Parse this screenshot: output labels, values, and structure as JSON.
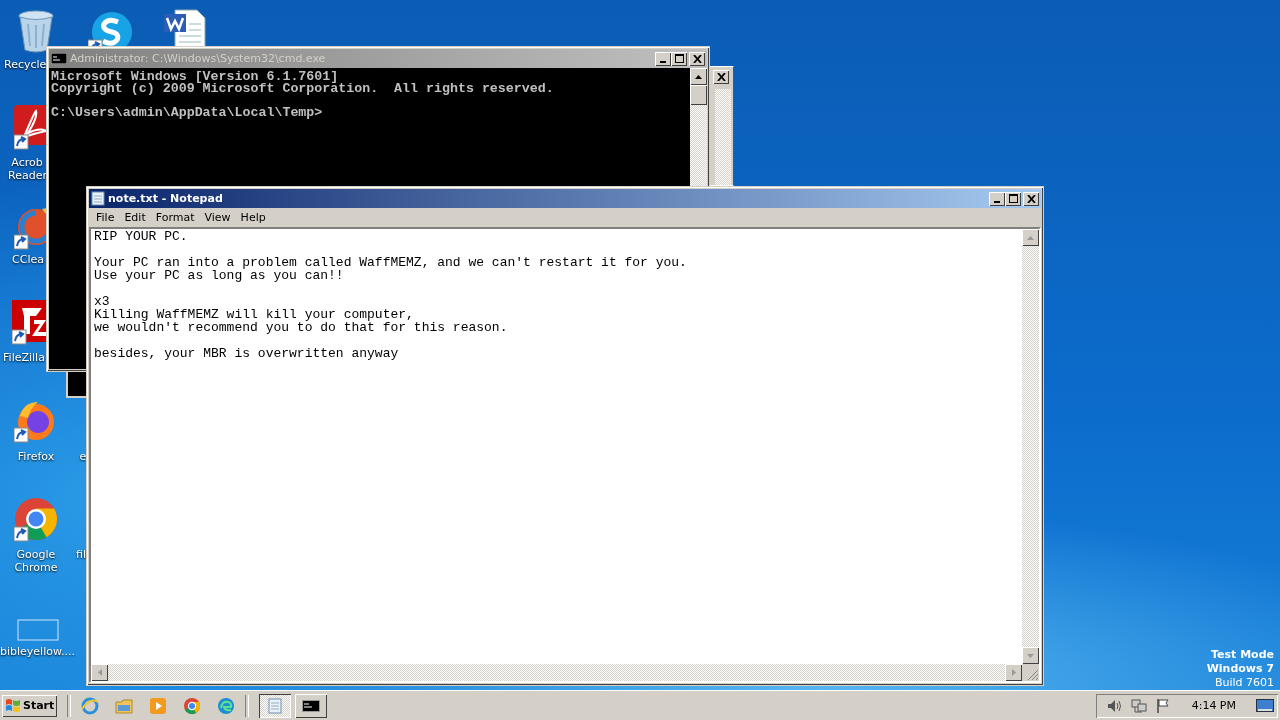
{
  "desktop": {
    "icons": [
      {
        "kind": "recycle",
        "shortcut": false,
        "label": [
          "Recycle"
        ]
      },
      {
        "kind": "skype",
        "shortcut": true
      },
      {
        "kind": "word",
        "shortcut": false
      },
      {
        "kind": "acrobat",
        "shortcut": true,
        "label": [
          "Acrob",
          "Reader"
        ]
      },
      {
        "kind": "ccleaner",
        "shortcut": true,
        "label": [
          "CClea"
        ]
      },
      {
        "kind": "filezilla",
        "shortcut": true,
        "label": [
          "FileZilla"
        ]
      },
      {
        "kind": "firefox",
        "shortcut": true,
        "label": [
          "Firefox"
        ]
      },
      {
        "label": [
          "e"
        ]
      },
      {
        "kind": "chrome",
        "shortcut": true,
        "label": [
          "Google",
          "Chrome"
        ]
      },
      {
        "label": [
          "fil"
        ]
      },
      {
        "kind": "blank",
        "shortcut": false,
        "label": [
          "bibleyellow...."
        ]
      }
    ],
    "test_mode": [
      "Test Mode",
      "Windows 7",
      "Build 7601"
    ]
  },
  "cmd_window": {
    "title": "Administrator: C:\\Windows\\System32\\cmd.exe",
    "active": false,
    "blocks": [
      [
        "Microsoft Windows [Version 6.1.7601]",
        "Copyright (c) 2009 Microsoft Corporation.  All rights reserved."
      ],
      [
        "C:\\Users\\admin\\AppData\\Local\\Temp>"
      ]
    ]
  },
  "notepad": {
    "title": "note.txt - Notepad",
    "active": true,
    "menu": [
      "File",
      "Edit",
      "Format",
      "View",
      "Help"
    ],
    "paragraphs": [
      [
        "RIP YOUR PC."
      ],
      [
        "Your PC ran into a problem called WaffMEMZ, and we can't restart it for you.",
        "Use your PC as long as you can!!"
      ],
      [
        "x3",
        "Killing WaffMEMZ will kill your computer,",
        "we wouldn't recommend you to do that for this reason."
      ],
      [
        "besides, your MBR is overwritten anyway"
      ]
    ]
  },
  "taskbar": {
    "start": "Start",
    "quick_launch": [
      {
        "kind": "ie"
      },
      {
        "kind": "explorer"
      },
      {
        "kind": "media"
      },
      {
        "kind": "chrome"
      },
      {
        "kind": "edge"
      }
    ],
    "tasks": [
      {
        "kind": "notepad",
        "selected": true
      },
      {
        "kind": "cmd",
        "selected": false
      }
    ],
    "tray": [
      {
        "kind": "speaker"
      },
      {
        "kind": "network"
      },
      {
        "kind": "flag"
      }
    ],
    "clock": "4:14 PM"
  }
}
